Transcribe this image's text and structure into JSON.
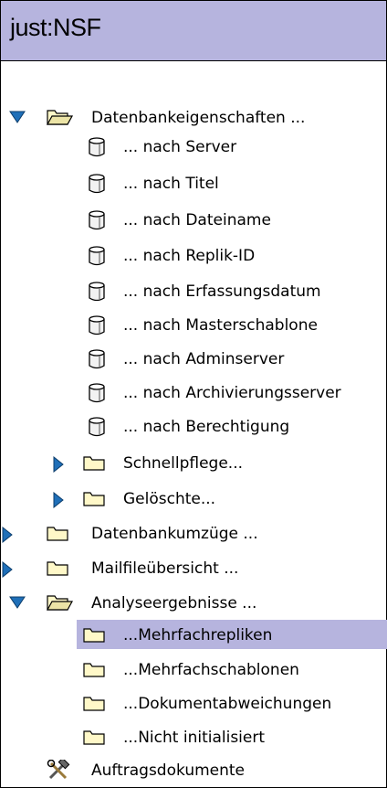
{
  "window": {
    "title": "just:NSF"
  },
  "tree": {
    "datenbank": {
      "label": "Datenbankeigenschaften ...",
      "children": [
        "... nach Server",
        "... nach Titel",
        "... nach Dateiname",
        "... nach Replik-ID",
        "... nach Erfassungsdatum",
        "... nach Masterschablone",
        "... nach Adminserver",
        "... nach Archivierungsserver",
        "... nach Berechtigung"
      ],
      "schnellpflege": "Schnellpflege...",
      "geloeschte": "Gelöschte..."
    },
    "umzuege": "Datenbankumzüge ...",
    "mailfile": "Mailfileübersicht ...",
    "analyse": {
      "label": "Analyseergebnisse ...",
      "children": [
        "...Mehrfachrepliken",
        "...Mehrfachschablonen",
        "...Dokumentabweichungen",
        "...Nicht initialisiert"
      ],
      "selected_index": 0
    },
    "auftrag": "Auftragsdokumente"
  },
  "colors": {
    "title_bg": "#b6b4de",
    "selection_bg": "#b6b4de",
    "twisty": "#1f6fb8",
    "folder_fill": "#fff8c8"
  },
  "icons": {
    "expanded": "triangle-down-icon",
    "collapsed": "triangle-right-icon",
    "open_folder": "open-folder-icon",
    "folder": "folder-icon",
    "database": "database-icon",
    "tools": "hammer-wrench-icon"
  }
}
